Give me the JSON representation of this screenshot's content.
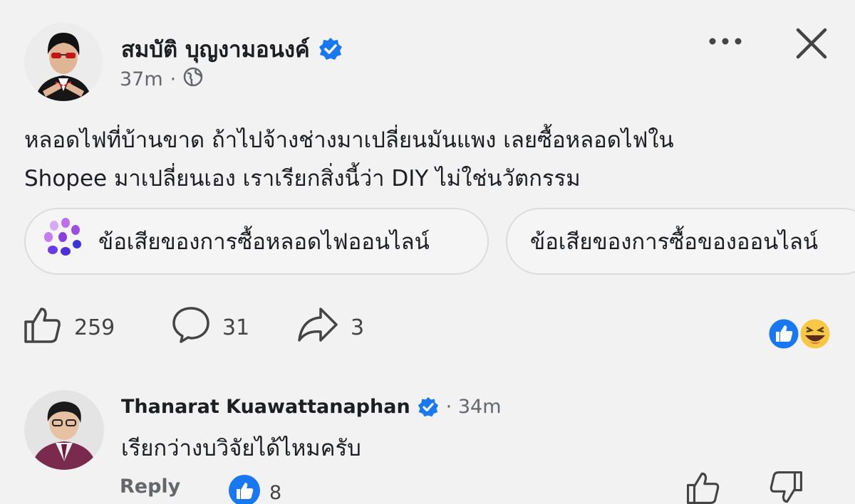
{
  "post": {
    "author": "สมบัติ บุญงามอนงค์",
    "time": "37m",
    "separator": "·",
    "text_line_1": "หลอดไฟที่บ้านขาด ถ้าไปจ้างช่างมาเปลี่ยนมันแพง เลยซื้อหลอดไฟใน",
    "text_line_2": "Shopee มาเปลี่ยนเอง เราเรียกสิ่งนี้ว่า DIY ไม่ใช่นวัตกรรม"
  },
  "suggestions": [
    {
      "label": "ข้อเสียของการซื้อหลอดไฟออนไลน์",
      "icon": "meta-ai-icon"
    },
    {
      "label": "ข้อเสียของการซื้อของออนไลน์"
    }
  ],
  "actions": {
    "likes": "259",
    "comments": "31",
    "shares": "3"
  },
  "reactions": [
    "like-reaction-icon",
    "haha-reaction-icon"
  ],
  "comment": {
    "author": "Thanarat Kuawattanaphan",
    "time": "· 34m",
    "text": "เรียกว่างบวิจัยได้ไหมครับ",
    "reply_label": "Reply",
    "like_count": "8"
  },
  "colors": {
    "verified_blue": "#1877f2",
    "background": "#f2f2f2",
    "text_secondary": "#65676b"
  }
}
